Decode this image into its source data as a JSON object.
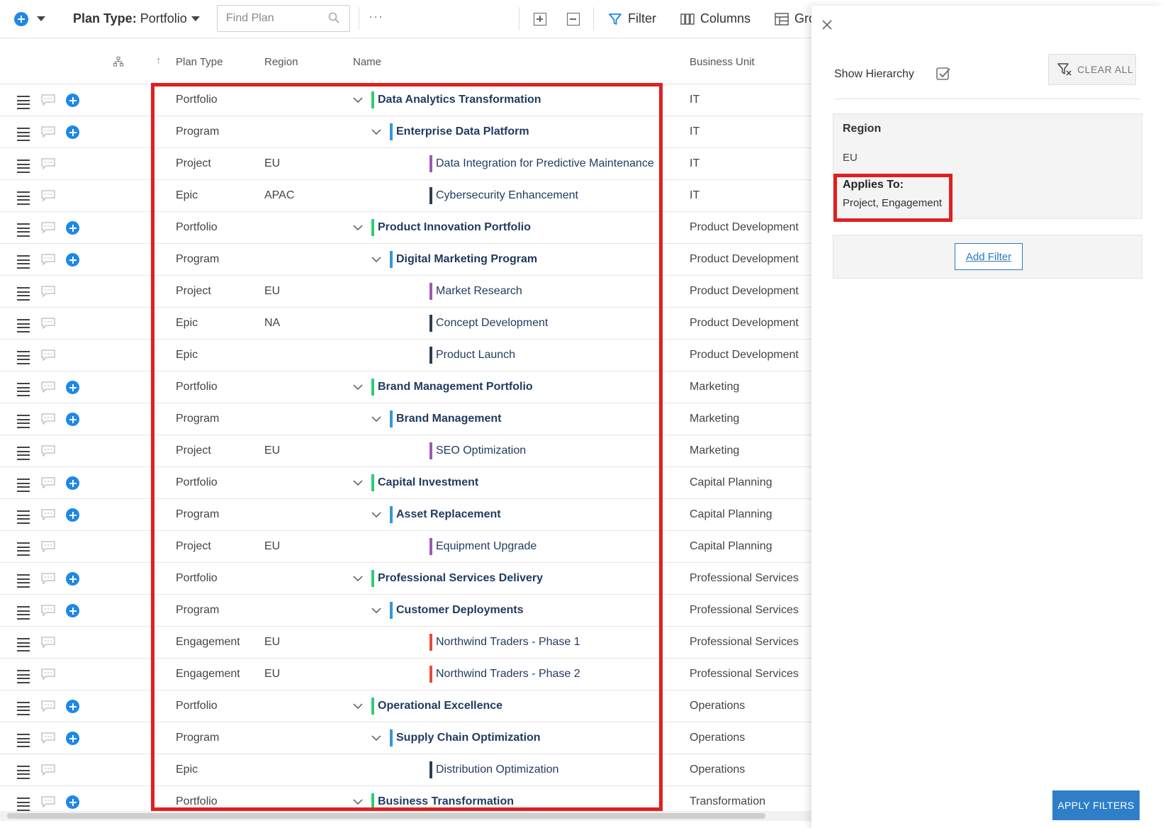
{
  "toolbar": {
    "plan_type_label": "Plan Type:",
    "plan_type_value": "Portfolio",
    "search_placeholder": "Find Plan",
    "more_label": "···",
    "filter_label": "Filter",
    "columns_label": "Columns",
    "group_label": "Gro"
  },
  "grid": {
    "headers": {
      "plan_type": "Plan Type",
      "region": "Region",
      "name": "Name",
      "business_unit": "Business Unit"
    },
    "rows": [
      {
        "type": "Portfolio",
        "region": "",
        "name": "Data Analytics Transformation",
        "level": 0,
        "bu": "IT",
        "addable": true,
        "color": "#2ecc71"
      },
      {
        "type": "Program",
        "region": "",
        "name": "Enterprise Data Platform",
        "level": 1,
        "bu": "IT",
        "addable": true,
        "color": "#3498db"
      },
      {
        "type": "Project",
        "region": "EU",
        "name": "Data Integration for Predictive Maintenance",
        "level": 2,
        "bu": "IT",
        "addable": false,
        "color": "#9b59b6"
      },
      {
        "type": "Epic",
        "region": "APAC",
        "name": "Cybersecurity Enhancement",
        "level": 2,
        "bu": "IT",
        "addable": false,
        "color": "#2c3e50"
      },
      {
        "type": "Portfolio",
        "region": "",
        "name": "Product Innovation Portfolio",
        "level": 0,
        "bu": "Product Development",
        "addable": true,
        "color": "#2ecc71"
      },
      {
        "type": "Program",
        "region": "",
        "name": "Digital Marketing Program",
        "level": 1,
        "bu": "Product Development",
        "addable": true,
        "color": "#3498db"
      },
      {
        "type": "Project",
        "region": "EU",
        "name": "Market Research",
        "level": 2,
        "bu": "Product Development",
        "addable": false,
        "color": "#9b59b6"
      },
      {
        "type": "Epic",
        "region": "NA",
        "name": "Concept Development",
        "level": 2,
        "bu": "Product Development",
        "addable": false,
        "color": "#2c3e50"
      },
      {
        "type": "Epic",
        "region": "",
        "name": "Product Launch",
        "level": 2,
        "bu": "Product Development",
        "addable": false,
        "color": "#2c3e50"
      },
      {
        "type": "Portfolio",
        "region": "",
        "name": "Brand Management Portfolio",
        "level": 0,
        "bu": "Marketing",
        "addable": true,
        "color": "#2ecc71"
      },
      {
        "type": "Program",
        "region": "",
        "name": "Brand Management",
        "level": 1,
        "bu": "Marketing",
        "addable": true,
        "color": "#3498db"
      },
      {
        "type": "Project",
        "region": "EU",
        "name": "SEO Optimization",
        "level": 2,
        "bu": "Marketing",
        "addable": false,
        "color": "#9b59b6"
      },
      {
        "type": "Portfolio",
        "region": "",
        "name": "Capital Investment",
        "level": 0,
        "bu": "Capital Planning",
        "addable": true,
        "color": "#2ecc71"
      },
      {
        "type": "Program",
        "region": "",
        "name": "Asset Replacement",
        "level": 1,
        "bu": "Capital Planning",
        "addable": true,
        "color": "#3498db"
      },
      {
        "type": "Project",
        "region": "EU",
        "name": "Equipment Upgrade",
        "level": 2,
        "bu": "Capital Planning",
        "addable": false,
        "color": "#9b59b6"
      },
      {
        "type": "Portfolio",
        "region": "",
        "name": "Professional Services Delivery",
        "level": 0,
        "bu": "Professional Services",
        "addable": true,
        "color": "#2ecc71"
      },
      {
        "type": "Program",
        "region": "",
        "name": "Customer Deployments",
        "level": 1,
        "bu": "Professional Services",
        "addable": true,
        "color": "#3498db"
      },
      {
        "type": "Engagement",
        "region": "EU",
        "name": "Northwind Traders - Phase 1",
        "level": 2,
        "bu": "Professional Services",
        "addable": false,
        "color": "#e74c3c"
      },
      {
        "type": "Engagement",
        "region": "EU",
        "name": "Northwind Traders - Phase 2",
        "level": 2,
        "bu": "Professional Services",
        "addable": false,
        "color": "#e74c3c"
      },
      {
        "type": "Portfolio",
        "region": "",
        "name": "Operational Excellence",
        "level": 0,
        "bu": "Operations",
        "addable": true,
        "color": "#2ecc71"
      },
      {
        "type": "Program",
        "region": "",
        "name": "Supply Chain Optimization",
        "level": 1,
        "bu": "Operations",
        "addable": true,
        "color": "#3498db"
      },
      {
        "type": "Epic",
        "region": "",
        "name": "Distribution Optimization",
        "level": 2,
        "bu": "Operations",
        "addable": false,
        "color": "#2c3e50"
      },
      {
        "type": "Portfolio",
        "region": "",
        "name": "Business Transformation",
        "level": 0,
        "bu": "Transformation",
        "addable": true,
        "color": "#2ecc71"
      }
    ]
  },
  "panel": {
    "show_hierarchy_label": "Show Hierarchy",
    "show_hierarchy_checked": true,
    "clear_all_label": "CLEAR ALL",
    "filter": {
      "title": "Region",
      "value": "EU",
      "applies_label": "Applies To:",
      "applies_value": "Project, Engagement"
    },
    "add_filter_label": "Add Filter",
    "apply_label": "APPLY FILTERS"
  },
  "colors": {
    "accent": "#1e88e5",
    "highlight": "#e02020",
    "apply_button": "#2f7fc8"
  }
}
